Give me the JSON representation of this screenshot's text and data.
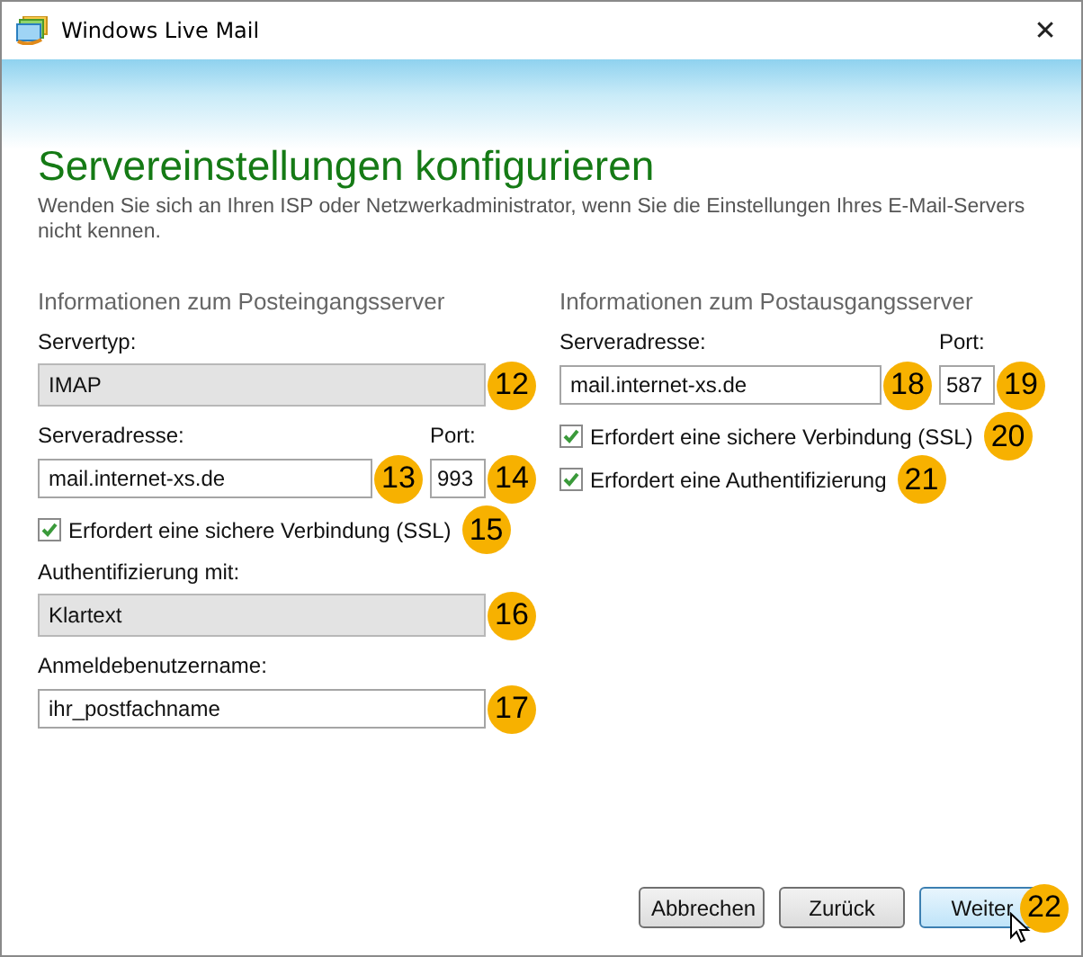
{
  "window": {
    "title": "Windows Live Mail",
    "close": "✕"
  },
  "heading": "Servereinstellungen konfigurieren",
  "description": "Wenden Sie sich an Ihren ISP oder Netzwerkadministrator, wenn Sie die Einstellungen Ihres E-Mail-Servers nicht kennen.",
  "columns": [
    {
      "title": "Informationen zum Posteingangsserver",
      "rows": [
        {
          "kind": "select",
          "label": "Servertyp:",
          "value": "IMAP",
          "badge": "12"
        },
        {
          "kind": "address",
          "label": "Serveradresse:",
          "value": "mail.internet-xs.de",
          "badge": "13",
          "port_label": "Port:",
          "port": "993",
          "port_badge": "14"
        },
        {
          "kind": "checkbox",
          "label": "Erfordert eine sichere Verbindung (SSL)",
          "checked": true,
          "badge": "15"
        },
        {
          "kind": "select",
          "label": "Authentifizierung mit:",
          "value": "Klartext",
          "badge": "16"
        },
        {
          "kind": "text",
          "label": "Anmeldebenutzername:",
          "value": "ihr_postfachname",
          "badge": "17"
        }
      ]
    },
    {
      "title": "Informationen zum Postausgangsserver",
      "rows": [
        {
          "kind": "address",
          "label": "Serveradresse:",
          "value": "mail.internet-xs.de",
          "badge": "18",
          "port_label": "Port:",
          "port": "587",
          "port_badge": "19"
        },
        {
          "kind": "checkbox",
          "label": "Erfordert eine sichere Verbindung (SSL)",
          "checked": true,
          "badge": "20"
        },
        {
          "kind": "checkbox",
          "label": "Erfordert eine Authentifizierung",
          "checked": true,
          "badge": "21"
        }
      ]
    }
  ],
  "buttons": [
    {
      "label": "Abbrechen",
      "highlighted": false
    },
    {
      "label": "Zurück",
      "highlighted": false
    },
    {
      "label": "Weiter",
      "highlighted": true,
      "badge": "22"
    }
  ]
}
